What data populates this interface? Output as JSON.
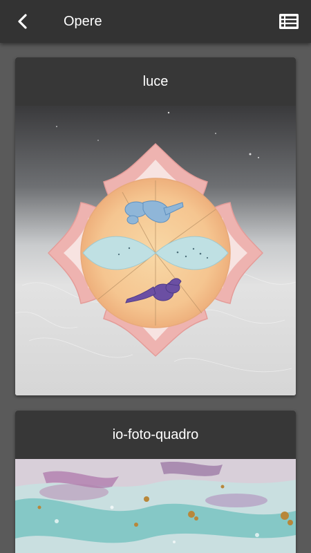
{
  "header": {
    "title": "Opere",
    "back_icon": "chevron-left-icon",
    "list_icon": "list-view-icon"
  },
  "artworks": [
    {
      "title": "luce"
    },
    {
      "title": "io-foto-quadro"
    }
  ],
  "colors": {
    "appbar": "#333333",
    "background": "#5a5a5a",
    "card_header": "#373737"
  }
}
